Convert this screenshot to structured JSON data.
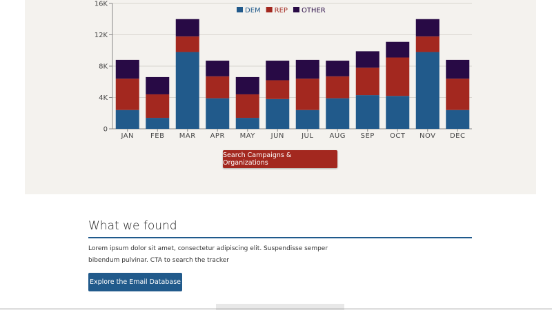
{
  "chart_data": {
    "type": "bar",
    "stacked": true,
    "categories": [
      "JAN",
      "FEB",
      "MAR",
      "APR",
      "MAY",
      "JUN",
      "JUL",
      "AUG",
      "SEP",
      "OCT",
      "NOV",
      "DEC"
    ],
    "series": [
      {
        "name": "DEM",
        "color": "#215a8b",
        "values": [
          2400,
          1400,
          9800,
          3900,
          1400,
          3800,
          2400,
          3900,
          4300,
          4200,
          9800,
          2400
        ]
      },
      {
        "name": "REP",
        "color": "#a3281f",
        "values": [
          4000,
          3000,
          2000,
          2800,
          3000,
          2400,
          4000,
          2800,
          3500,
          4900,
          2000,
          4000
        ]
      },
      {
        "name": "OTHER",
        "color": "#280a45",
        "values": [
          2400,
          2200,
          2200,
          2000,
          2200,
          2500,
          2400,
          2000,
          2100,
          2000,
          2200,
          2400
        ]
      }
    ],
    "yticks": [
      "0",
      "4K",
      "8K",
      "12K",
      "16K"
    ],
    "ylim": [
      0,
      16000
    ],
    "grid": true,
    "legend": "top-center"
  },
  "cta": {
    "label": "Search Campaigns & Organizations"
  },
  "found": {
    "title": "What we found",
    "text": "Lorem ipsum dolor sit amet, consectetur adipiscing elit. Suspendisse semper bibendum pulvinar. CTA to search the tracker",
    "button_label": "Explore the Email Database"
  }
}
